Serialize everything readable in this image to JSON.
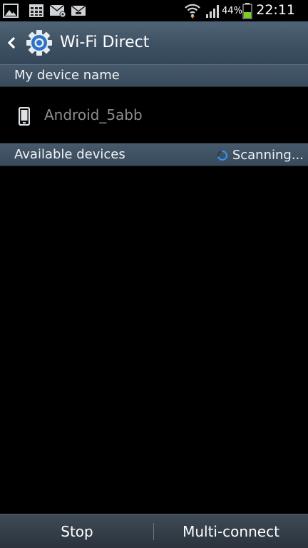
{
  "status_bar": {
    "left_icons": [
      "gallery-notification-icon",
      "calendar-notification-icon",
      "email-notification-icon",
      "message-notification-icon"
    ],
    "battery_percent": "44%",
    "battery_level": 0.44,
    "time": "22:11"
  },
  "action_bar": {
    "title": "Wi-Fi Direct",
    "back_icon": "chevron-left-icon",
    "app_icon": "settings-gear-icon"
  },
  "sections": {
    "my_device": {
      "header": "My device name",
      "device_name": "Android_5abb",
      "icon": "phone-icon"
    },
    "available": {
      "header": "Available devices",
      "status": "Scanning...",
      "status_icon": "spinner-icon"
    }
  },
  "bottom_bar": {
    "stop_label": "Stop",
    "multi_connect_label": "Multi-connect"
  },
  "colors": {
    "action_bar": "#3e5163",
    "section_header": "#3f5264",
    "device_name_text": "#8b8e91",
    "accent_blue": "#3a8fe0",
    "battery_green": "#7ccf1c"
  }
}
